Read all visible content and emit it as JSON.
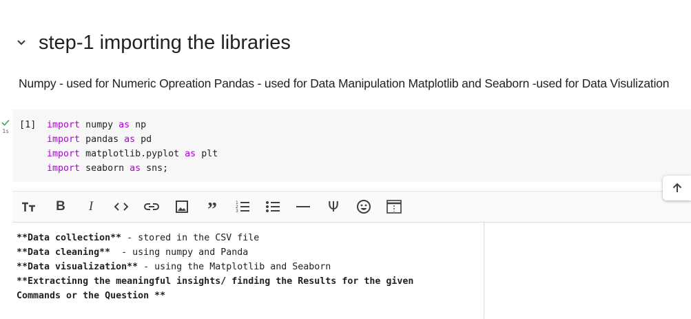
{
  "section": {
    "title": "step-1 importing the libraries",
    "description": "Numpy - used for Numeric Opreation Pandas - used for Data Manipulation Matplotlib and Seaborn -used for Data Visulization"
  },
  "code_cell": {
    "exec_count": "[1]",
    "exec_time": "1s",
    "lines": [
      {
        "kw1": "import",
        "mod": "numpy",
        "kw2": "as",
        "alias": "np"
      },
      {
        "kw1": "import",
        "mod": "pandas",
        "kw2": "as",
        "alias": "pd"
      },
      {
        "kw1": "import",
        "mod": "matplotlib.pyplot",
        "kw2": "as",
        "alias": "plt"
      },
      {
        "kw1": "import",
        "mod": "seaborn",
        "kw2": "as",
        "alias": "sns;"
      }
    ]
  },
  "toolbar_icons": [
    "text-size-icon",
    "bold-icon",
    "italic-icon",
    "code-icon",
    "link-icon",
    "image-icon",
    "quote-icon",
    "numbered-list-icon",
    "bullet-list-icon",
    "horizontal-rule-icon",
    "latex-icon",
    "emoji-icon",
    "preview-toggle-icon"
  ],
  "markdown": {
    "lines": [
      {
        "bold": "**Data collection**",
        "rest": " - stored in the CSV file"
      },
      {
        "bold": "**Data cleaning**",
        "rest": "  - using numpy and Panda"
      },
      {
        "bold": "**Data visualization**",
        "rest": " - using the Matplotlib and Seaborn"
      },
      {
        "bold": "**Extractinng the meaningful insights/ finding the Results for the given",
        "rest": ""
      },
      {
        "bold": "Commands or the Question **",
        "rest": ""
      }
    ]
  },
  "colors": {
    "keyword": "#af00db",
    "success": "#34a853"
  }
}
